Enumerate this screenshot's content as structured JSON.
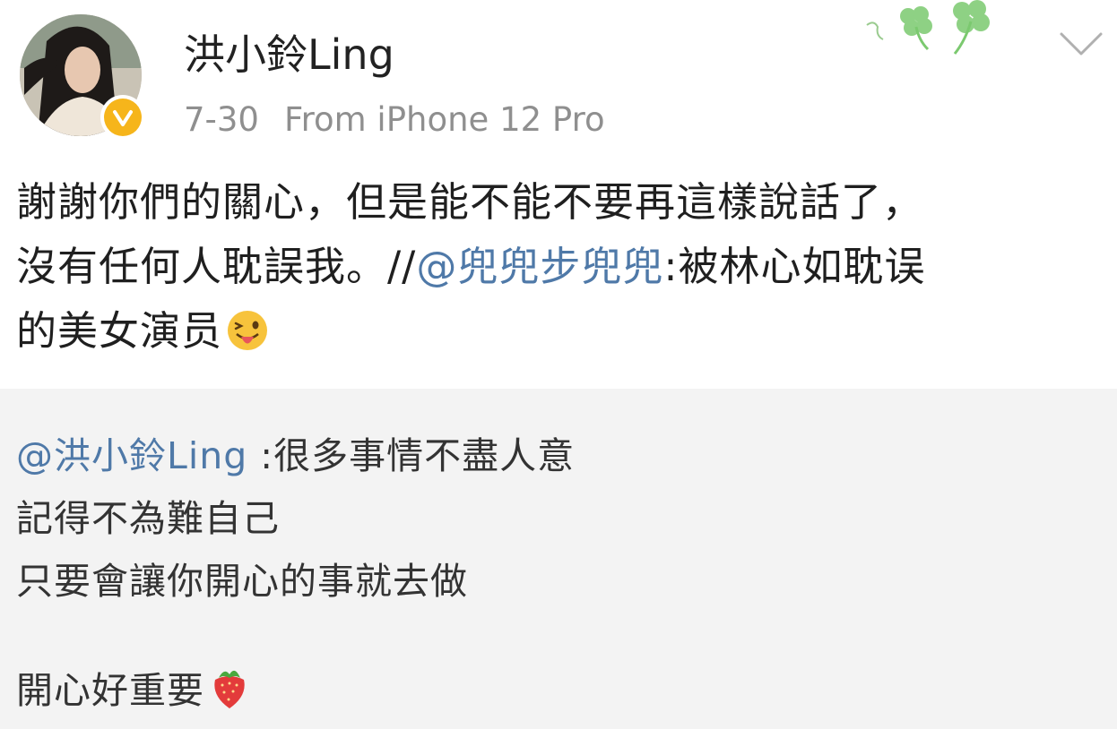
{
  "post": {
    "username": "洪小鈴Ling",
    "date": "7-30",
    "source": "From iPhone 12 Pro",
    "text_line1": "謝謝你們的關心，但是能不能不要再這樣說話了，",
    "text_line2_prefix": "沒有任何人耽誤我。//",
    "mention": "@兜兜步兜兜",
    "text_line2_suffix": ":被林心如耽误",
    "text_line3": "的美女演员",
    "emoji_icon": "tongue-wink-emoji"
  },
  "repost": {
    "mention": "@洪小鈴Ling",
    "line1_text": " :很多事情不盡人意",
    "line2": "記得不為難自己",
    "line3": "只要會讓你開心的事就去做",
    "line4": "開心好重要",
    "emoji_icon": "strawberry-emoji"
  },
  "colors": {
    "mention": "#4f79a8",
    "verified": "#f6b51b",
    "meta_gray": "#8f8f8f",
    "repost_bg": "#f3f3f3",
    "clover": "#6cc36a"
  }
}
